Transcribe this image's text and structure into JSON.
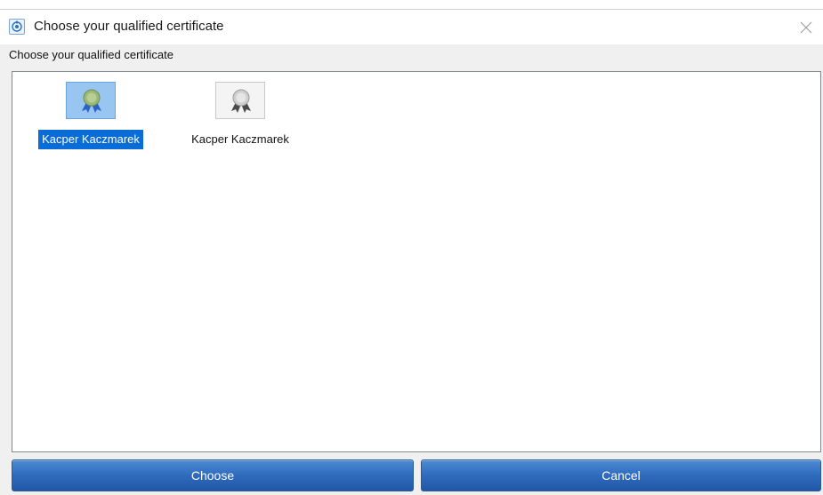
{
  "window": {
    "title": "Choose your qualified certificate",
    "icon": "app-seal-icon",
    "close_icon": "close-icon"
  },
  "dialog": {
    "prompt": "Choose your qualified certificate"
  },
  "certificates": [
    {
      "name": "Kacper Kaczmarek",
      "icon": "certificate-icon",
      "selected": true
    },
    {
      "name": "Kacper Kaczmarek",
      "icon": "certificate-icon",
      "selected": false
    }
  ],
  "buttons": {
    "choose_label": "Choose",
    "cancel_label": "Cancel"
  },
  "colors": {
    "button_blue": "#2f6bbd",
    "selection_blue": "#0a6cd6",
    "selected_thumb": "#99c5f1"
  }
}
